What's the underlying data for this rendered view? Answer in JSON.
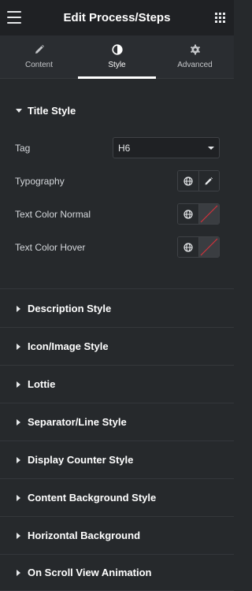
{
  "header": {
    "title": "Edit Process/Steps",
    "menu_icon": "hamburger-icon",
    "apps_icon": "grid-icon"
  },
  "tabs": [
    {
      "label": "Content",
      "icon": "pencil-icon",
      "active": false
    },
    {
      "label": "Style",
      "icon": "half-circle-icon",
      "active": true
    },
    {
      "label": "Advanced",
      "icon": "gear-icon",
      "active": false
    }
  ],
  "title_style": {
    "heading": "Title Style",
    "tag_label": "Tag",
    "tag_value": "H6",
    "typography_label": "Typography",
    "text_color_normal_label": "Text Color Normal",
    "text_color_hover_label": "Text Color Hover"
  },
  "sections": [
    "Description Style",
    "Icon/Image Style",
    "Lottie",
    "Separator/Line Style",
    "Display Counter Style",
    "Content Background Style",
    "Horizontal Background",
    "On Scroll View Animation"
  ],
  "colors": {
    "background": "#26292c",
    "header_bg": "#1f2124",
    "active_tab_indicator": "#ffffff",
    "unset_color_slash": "#d2323c"
  }
}
